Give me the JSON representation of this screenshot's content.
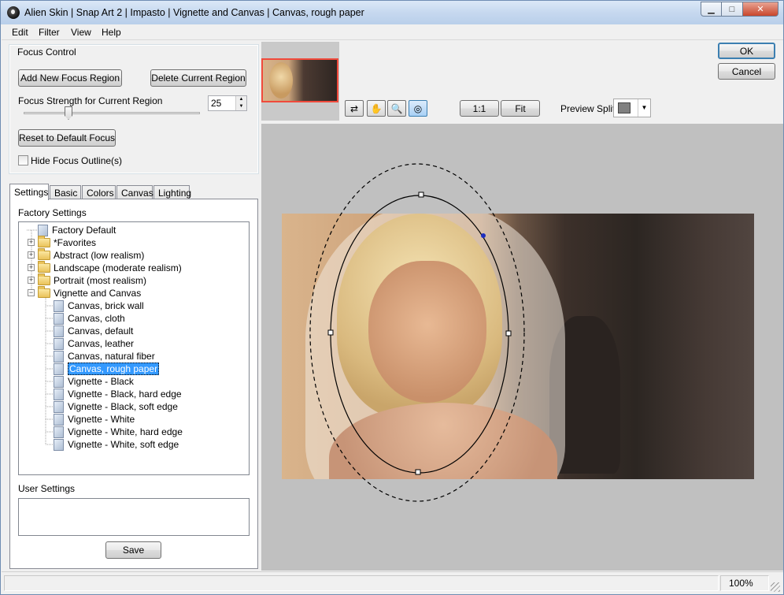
{
  "window": {
    "title": "Alien Skin | Snap Art 2 | Impasto | Vignette and Canvas | Canvas, rough paper"
  },
  "menu": [
    "Edit",
    "Filter",
    "View",
    "Help"
  ],
  "focus_control": {
    "group_label": "Focus Control",
    "add_label": "Add New Focus Region",
    "delete_label": "Delete Current Region",
    "strength_label": "Focus Strength for Current Region",
    "strength_value": "25",
    "reset_label": "Reset to Default Focus",
    "hide_label": "Hide Focus Outline(s)"
  },
  "tabs": [
    "Settings",
    "Basic",
    "Colors",
    "Canvas",
    "Lighting"
  ],
  "settings": {
    "factory_label": "Factory Settings",
    "tree": [
      {
        "label": "Factory Default",
        "type": "doc",
        "level": 0
      },
      {
        "label": "*Favorites",
        "type": "folder",
        "level": 0,
        "expander": "+"
      },
      {
        "label": "Abstract (low realism)",
        "type": "folder",
        "level": 0,
        "expander": "+"
      },
      {
        "label": "Landscape (moderate realism)",
        "type": "folder",
        "level": 0,
        "expander": "+"
      },
      {
        "label": "Portrait (most realism)",
        "type": "folder",
        "level": 0,
        "expander": "+"
      },
      {
        "label": "Vignette and Canvas",
        "type": "folder",
        "level": 0,
        "expander": "−"
      },
      {
        "label": "Canvas, brick wall",
        "type": "doc",
        "level": 1
      },
      {
        "label": "Canvas, cloth",
        "type": "doc",
        "level": 1
      },
      {
        "label": "Canvas, default",
        "type": "doc",
        "level": 1
      },
      {
        "label": "Canvas, leather",
        "type": "doc",
        "level": 1
      },
      {
        "label": "Canvas, natural fiber",
        "type": "doc",
        "level": 1
      },
      {
        "label": "Canvas, rough paper",
        "type": "doc",
        "level": 1,
        "selected": true
      },
      {
        "label": "Vignette - Black",
        "type": "doc",
        "level": 1
      },
      {
        "label": "Vignette - Black, hard edge",
        "type": "doc",
        "level": 1
      },
      {
        "label": "Vignette - Black, soft edge",
        "type": "doc",
        "level": 1
      },
      {
        "label": "Vignette - White",
        "type": "doc",
        "level": 1
      },
      {
        "label": "Vignette - White, hard edge",
        "type": "doc",
        "level": 1
      },
      {
        "label": "Vignette - White, soft edge",
        "type": "doc",
        "level": 1
      }
    ],
    "user_label": "User Settings",
    "save_label": "Save"
  },
  "toolbar": {
    "tools": [
      {
        "name": "compare-before-after-icon",
        "glyph": "⇄"
      },
      {
        "name": "hand-pan-icon",
        "glyph": "✋"
      },
      {
        "name": "zoom-magnifier-icon",
        "glyph": "🔍"
      },
      {
        "name": "focus-target-icon",
        "glyph": "◎",
        "active": true
      }
    ],
    "zoom_1to1_label": "1:1",
    "fit_label": "Fit",
    "preview_split_label": "Preview Split:",
    "preview_split_color": "#808080"
  },
  "dialog": {
    "ok_label": "OK",
    "cancel_label": "Cancel"
  },
  "status": {
    "zoom": "100%"
  },
  "colors": {
    "accent_ok_border": "#3c7fb1",
    "thumb_border": "#f04a3c",
    "selection": "#3399ff"
  }
}
